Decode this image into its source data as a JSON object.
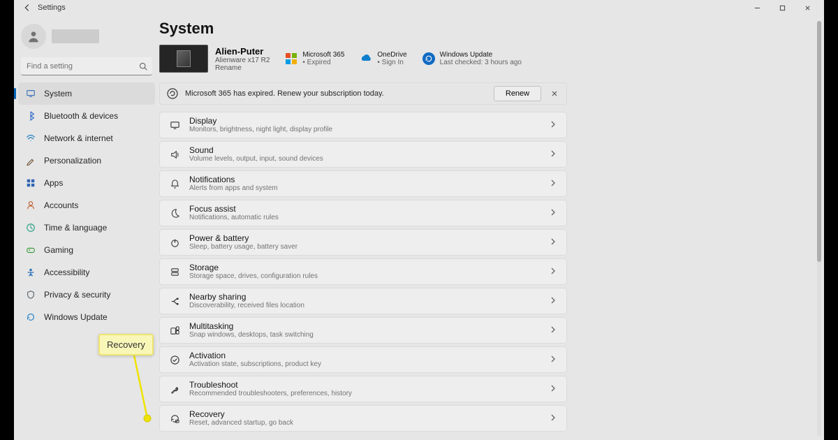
{
  "app": {
    "title": "Settings"
  },
  "search": {
    "placeholder": "Find a setting"
  },
  "nav": [
    {
      "label": "System",
      "icon": "monitor",
      "color": "#3b78c4",
      "selected": true
    },
    {
      "label": "Bluetooth & devices",
      "icon": "bluetooth",
      "color": "#2f6fd0"
    },
    {
      "label": "Network & internet",
      "icon": "wifi",
      "color": "#2f8ed0"
    },
    {
      "label": "Personalization",
      "icon": "brush",
      "color": "#6b4b2a"
    },
    {
      "label": "Apps",
      "icon": "grid",
      "color": "#3066be"
    },
    {
      "label": "Accounts",
      "icon": "person",
      "color": "#c95b2e"
    },
    {
      "label": "Time & language",
      "icon": "clock",
      "color": "#2aa88f"
    },
    {
      "label": "Gaming",
      "icon": "game",
      "color": "#3aa13a"
    },
    {
      "label": "Accessibility",
      "icon": "access",
      "color": "#2276c3"
    },
    {
      "label": "Privacy & security",
      "icon": "shield",
      "color": "#5b6670"
    },
    {
      "label": "Windows Update",
      "icon": "update",
      "color": "#1b85d6"
    }
  ],
  "page": {
    "title": "System"
  },
  "pc": {
    "name": "Alien-Puter",
    "model": "Alienware x17 R2",
    "rename": "Rename"
  },
  "status": {
    "m365": {
      "label": "Microsoft 365",
      "sub": "•  Expired"
    },
    "onedrive": {
      "label": "OneDrive",
      "sub": "•  Sign In"
    },
    "update": {
      "label": "Windows Update",
      "sub": "Last checked: 3 hours ago"
    }
  },
  "banner": {
    "text": "Microsoft 365 has expired. Renew your subscription today.",
    "renew": "Renew"
  },
  "cards": [
    {
      "title": "Display",
      "sub": "Monitors, brightness, night light, display profile",
      "icon": "display"
    },
    {
      "title": "Sound",
      "sub": "Volume levels, output, input, sound devices",
      "icon": "sound"
    },
    {
      "title": "Notifications",
      "sub": "Alerts from apps and system",
      "icon": "bell"
    },
    {
      "title": "Focus assist",
      "sub": "Notifications, automatic rules",
      "icon": "moon"
    },
    {
      "title": "Power & battery",
      "sub": "Sleep, battery usage, battery saver",
      "icon": "power"
    },
    {
      "title": "Storage",
      "sub": "Storage space, drives, configuration rules",
      "icon": "storage"
    },
    {
      "title": "Nearby sharing",
      "sub": "Discoverability, received files location",
      "icon": "share"
    },
    {
      "title": "Multitasking",
      "sub": "Snap windows, desktops, task switching",
      "icon": "multi"
    },
    {
      "title": "Activation",
      "sub": "Activation state, subscriptions, product key",
      "icon": "check"
    },
    {
      "title": "Troubleshoot",
      "sub": "Recommended troubleshooters, preferences, history",
      "icon": "wrench"
    },
    {
      "title": "Recovery",
      "sub": "Reset, advanced startup, go back",
      "icon": "recovery"
    }
  ],
  "callout": {
    "text": "Recovery"
  }
}
